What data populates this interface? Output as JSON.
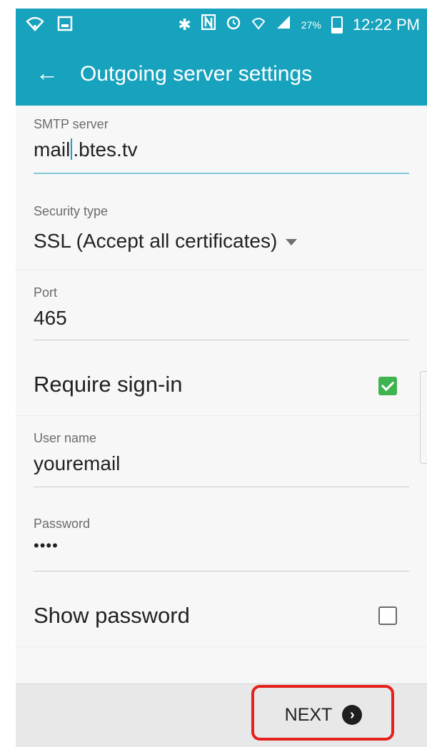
{
  "status_bar": {
    "battery_percent": "27%",
    "time": "12:22 PM",
    "icons": [
      "wifi-icon",
      "image-icon",
      "bluetooth-icon",
      "nfc-icon",
      "alarm-icon",
      "wifi-signal-icon",
      "cell-signal-icon",
      "battery-icon"
    ]
  },
  "app_bar": {
    "title": "Outgoing server settings"
  },
  "form": {
    "smtp_server": {
      "label": "SMTP server",
      "value_before_cursor": "mail",
      "value_after_cursor": ".btes.tv"
    },
    "security_type": {
      "label": "Security type",
      "value": "SSL (Accept all certificates)"
    },
    "port": {
      "label": "Port",
      "value": "465"
    },
    "require_sign_in": {
      "label": "Require sign-in",
      "checked": true
    },
    "user_name": {
      "label": "User name",
      "value": "youremail"
    },
    "password": {
      "label": "Password",
      "value": "••••"
    },
    "show_password": {
      "label": "Show password",
      "checked": false
    }
  },
  "footer": {
    "next_label": "NEXT"
  },
  "colors": {
    "accent": "#17a3bd",
    "checkbox_checked": "#3fb34f",
    "highlight": "#e5211c"
  }
}
